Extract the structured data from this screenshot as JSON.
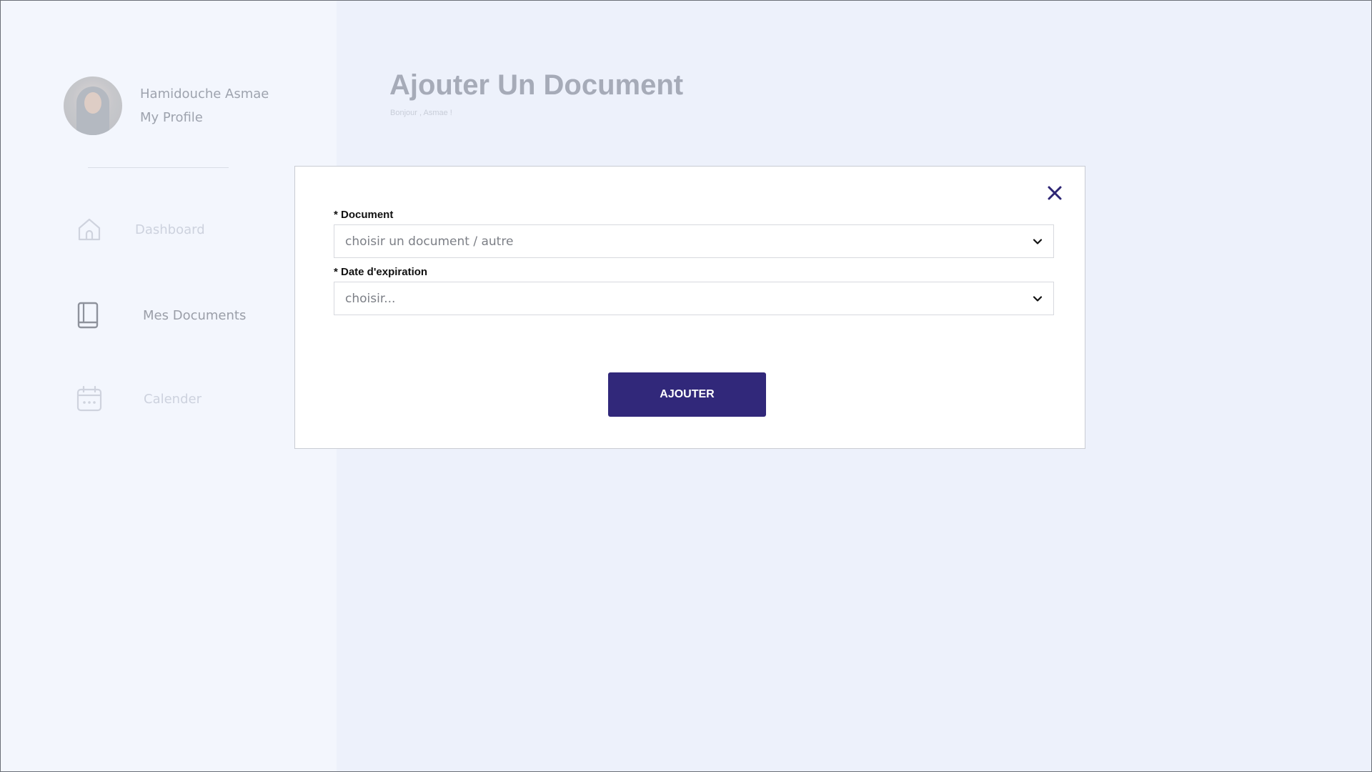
{
  "header": {
    "title": "Ajouter Un Document",
    "subtitle": "Bonjour , Asmae !"
  },
  "sidebar": {
    "profile": {
      "name": "Hamidouche Asmae",
      "link": "My Profile"
    },
    "items": [
      {
        "label": "Dashboard",
        "icon": "home-icon",
        "state": "faded"
      },
      {
        "label": "Mes Documents",
        "icon": "book-icon",
        "state": "active"
      },
      {
        "label": "Calender",
        "icon": "calendar-icon",
        "state": "faded"
      }
    ]
  },
  "modal": {
    "fields": [
      {
        "label": "* Document",
        "value": "choisir un document / autre"
      },
      {
        "label": "* Date d'expiration",
        "value": "choisir..."
      }
    ],
    "submit_label": "AJOUTER",
    "close_icon": "close-icon"
  },
  "colors": {
    "accent": "#31287a",
    "background": "#edf1fb",
    "sidebar": "#f3f6fd"
  }
}
